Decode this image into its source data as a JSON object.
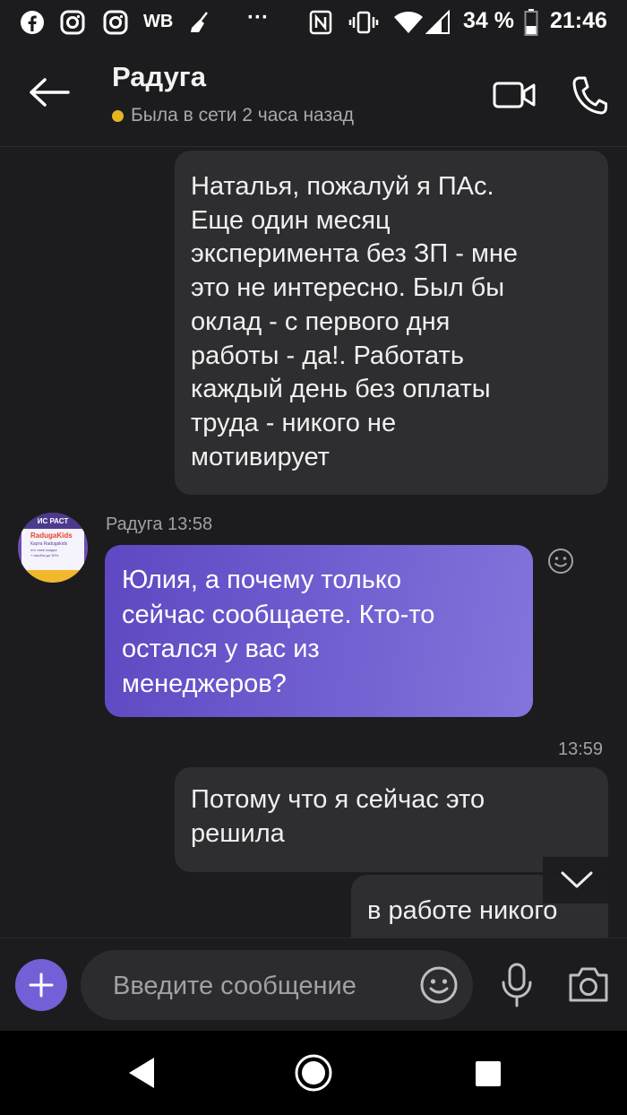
{
  "status_bar": {
    "wb_label": "WB",
    "dots": "···",
    "battery_percent": "34 %",
    "time": "21:46"
  },
  "header": {
    "contact_name": "Радуга",
    "presence": "Была в сети 2 часа назад"
  },
  "messages": [
    {
      "direction": "outgoing",
      "lines": [
        "Наталья, пожалуй я ПАс.",
        "Еще один месяц",
        "эксперимента без ЗП - мне",
        "это не интересно. Был бы",
        "оклад - с первого дня",
        "работы - да!. Работать",
        "каждый день без оплаты",
        "труда  - никого не",
        "мотивирует"
      ]
    },
    {
      "direction": "incoming",
      "sender": "Радуга",
      "time": "13:58",
      "avatar_text": [
        "ИС РАСТ",
        "RadugaKids",
        "Карта Radugakids",
        "это тоже скидка",
        "+ кэшбэк до 30%"
      ],
      "lines": [
        "Юлия, а почему только",
        "сейчас сообщаете. Кто-то",
        "остался у вас из",
        "менеджеров?"
      ]
    },
    {
      "direction": "outgoing",
      "time": "13:59",
      "lines": [
        "Потому что я сейчас это",
        "решила"
      ]
    },
    {
      "direction": "outgoing",
      "lines": [
        "в работе никого"
      ]
    }
  ],
  "composer": {
    "placeholder": "Введите сообщение"
  },
  "colors": {
    "background": "#1c1c1e",
    "outgoing_bubble": "#2e2e31",
    "incoming_gradient_start": "#5f48c2",
    "incoming_gradient_end": "#8275db",
    "accent": "#7360d6",
    "presence_dot": "#e6b422"
  },
  "icons": [
    "facebook-icon",
    "instagram-icon",
    "wb-icon",
    "broom-icon",
    "nfc-icon",
    "vibrate-icon",
    "wifi-icon",
    "signal-icon",
    "battery-icon",
    "back-arrow-icon",
    "video-call-icon",
    "phone-icon",
    "emoji-reaction-icon",
    "scroll-down-chevron-icon",
    "plus-icon",
    "emoji-icon",
    "microphone-icon",
    "camera-icon",
    "nav-back-icon",
    "nav-home-icon",
    "nav-recents-icon"
  ]
}
